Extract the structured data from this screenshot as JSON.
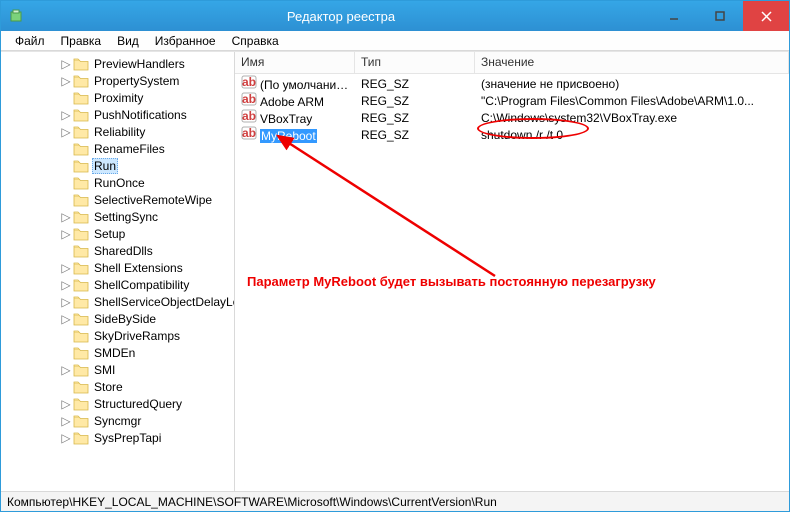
{
  "title": "Редактор реестра",
  "menus": [
    "Файл",
    "Правка",
    "Вид",
    "Избранное",
    "Справка"
  ],
  "tree_items": [
    {
      "indent": 58,
      "tw": "▷",
      "label": "PreviewHandlers"
    },
    {
      "indent": 58,
      "tw": "▷",
      "label": "PropertySystem"
    },
    {
      "indent": 58,
      "tw": "",
      "label": "Proximity"
    },
    {
      "indent": 58,
      "tw": "▷",
      "label": "PushNotifications"
    },
    {
      "indent": 58,
      "tw": "▷",
      "label": "Reliability"
    },
    {
      "indent": 58,
      "tw": "",
      "label": "RenameFiles"
    },
    {
      "indent": 58,
      "tw": "",
      "label": "Run",
      "selected": true
    },
    {
      "indent": 58,
      "tw": "",
      "label": "RunOnce"
    },
    {
      "indent": 58,
      "tw": "",
      "label": "SelectiveRemoteWipe"
    },
    {
      "indent": 58,
      "tw": "▷",
      "label": "SettingSync"
    },
    {
      "indent": 58,
      "tw": "▷",
      "label": "Setup"
    },
    {
      "indent": 58,
      "tw": "",
      "label": "SharedDlls"
    },
    {
      "indent": 58,
      "tw": "▷",
      "label": "Shell Extensions"
    },
    {
      "indent": 58,
      "tw": "▷",
      "label": "ShellCompatibility"
    },
    {
      "indent": 58,
      "tw": "▷",
      "label": "ShellServiceObjectDelayLoad"
    },
    {
      "indent": 58,
      "tw": "▷",
      "label": "SideBySide"
    },
    {
      "indent": 58,
      "tw": "",
      "label": "SkyDriveRamps"
    },
    {
      "indent": 58,
      "tw": "",
      "label": "SMDEn"
    },
    {
      "indent": 58,
      "tw": "▷",
      "label": "SMI"
    },
    {
      "indent": 58,
      "tw": "",
      "label": "Store"
    },
    {
      "indent": 58,
      "tw": "▷",
      "label": "StructuredQuery"
    },
    {
      "indent": 58,
      "tw": "▷",
      "label": "Syncmgr"
    },
    {
      "indent": 58,
      "tw": "▷",
      "label": "SysPrepTapi"
    }
  ],
  "columns": {
    "name": "Имя",
    "type": "Тип",
    "value": "Значение"
  },
  "rows": [
    {
      "name": "(По умолчанию)",
      "type": "REG_SZ",
      "value": "(значение не присвоено)"
    },
    {
      "name": "Adobe ARM",
      "type": "REG_SZ",
      "value": "\"C:\\Program Files\\Common Files\\Adobe\\ARM\\1.0..."
    },
    {
      "name": "VBoxTray",
      "type": "REG_SZ",
      "value": "C:\\Windows\\system32\\VBoxTray.exe"
    },
    {
      "name": "MyReboot",
      "type": "REG_SZ",
      "value": "shutdown /r /t 0",
      "selected": true
    }
  ],
  "status": "Компьютер\\HKEY_LOCAL_MACHINE\\SOFTWARE\\Microsoft\\Windows\\CurrentVersion\\Run",
  "annotation_text": "Параметр MyReboot будет вызывать постоянную перезагрузку"
}
